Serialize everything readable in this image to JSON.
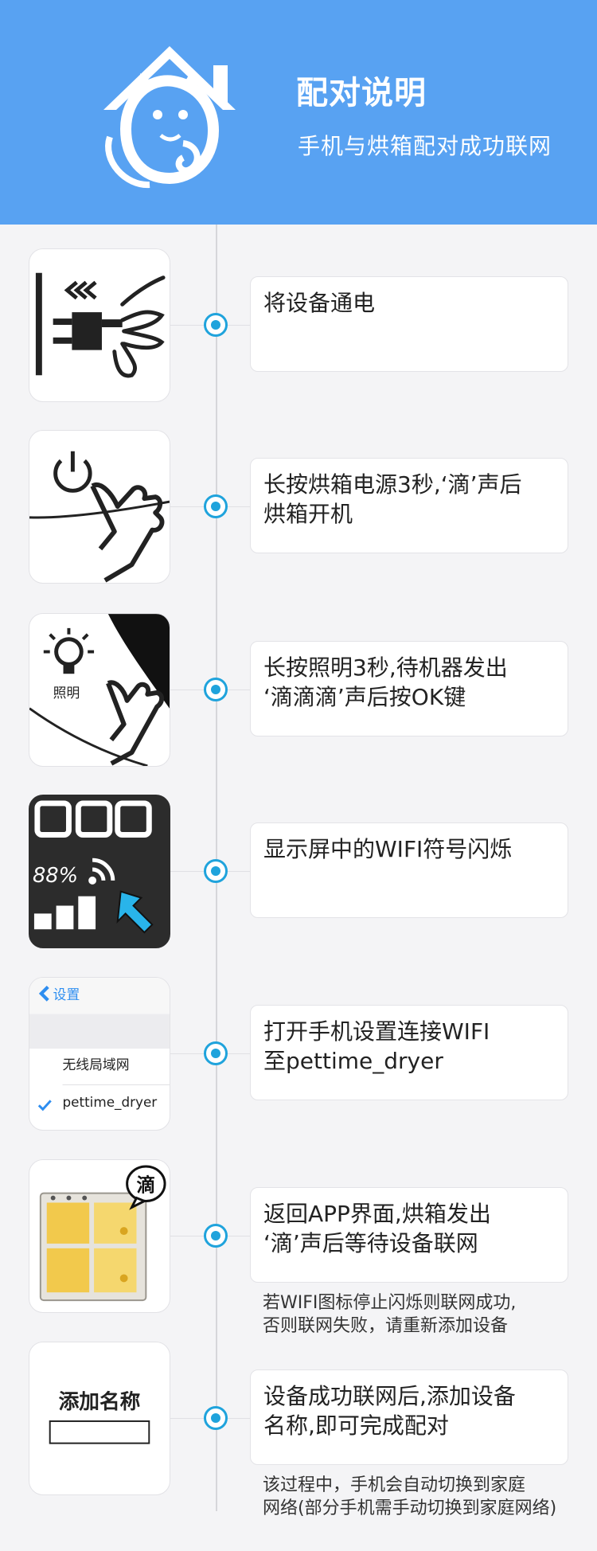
{
  "header": {
    "title": "配对说明",
    "subtitle": "手机与烘箱配对成功联网",
    "bg_color": "#58a2f2"
  },
  "accent_color": "#1fa3dc",
  "steps": [
    {
      "thumb_icon": "plug-icon",
      "lines": [
        "将设备通电"
      ]
    },
    {
      "thumb_icon": "power-press-icon",
      "lines": [
        "长按烘箱电源3秒,‘滴’声后",
        "烘箱开机"
      ]
    },
    {
      "thumb_icon": "light-press-icon",
      "thumb_label": "照明",
      "lines": [
        "长按照明3秒,待机器发出",
        "‘滴滴滴’声后按OK键"
      ]
    },
    {
      "thumb_icon": "display-wifi-icon",
      "thumb_label": "88%",
      "lines": [
        "显示屏中的WIFI符号闪烁"
      ]
    },
    {
      "thumb_icon": "phone-settings-icon",
      "settings_back": "设置",
      "settings_wlan": "无线局域网",
      "settings_network": "pettime_dryer",
      "lines": [
        "打开手机设置连接WIFI",
        "至pettime_dryer"
      ]
    },
    {
      "thumb_icon": "dryer-beep-icon",
      "thumb_label": "滴",
      "lines": [
        "返回APP界面,烘箱发出",
        "‘滴’声后等待设备联网"
      ],
      "note": [
        "若WIFI图标停止闪烁则联网成功,",
        "否则联网失败，请重新添加设备"
      ]
    },
    {
      "thumb_icon": "add-name-icon",
      "thumb_label": "添加名称",
      "lines": [
        "设备成功联网后,添加设备",
        "名称,即可完成配对"
      ],
      "note": [
        "该过程中，手机会自动切换到家庭",
        "网络(部分手机需手动切换到家庭网络)"
      ]
    }
  ]
}
